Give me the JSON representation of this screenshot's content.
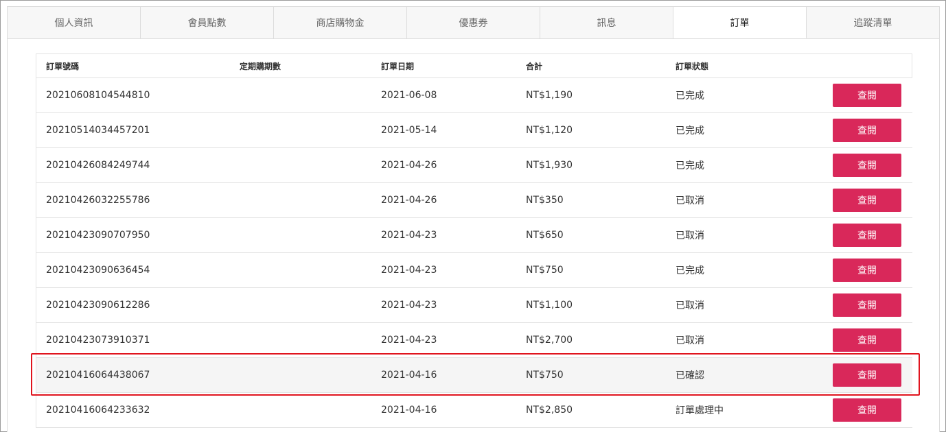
{
  "tabs": [
    {
      "label": "個人資訊",
      "active": false
    },
    {
      "label": "會員點數",
      "active": false
    },
    {
      "label": "商店購物金",
      "active": false
    },
    {
      "label": "優惠券",
      "active": false
    },
    {
      "label": "訊息",
      "active": false
    },
    {
      "label": "訂單",
      "active": true
    },
    {
      "label": "追蹤清單",
      "active": false
    }
  ],
  "table": {
    "headers": [
      "訂單號碼",
      "定期購期數",
      "訂單日期",
      "合計",
      "訂單狀態"
    ],
    "view_label": "查閱",
    "rows": [
      {
        "order_no": "20210608104544810",
        "period": "",
        "date": "2021-06-08",
        "total": "NT$1,190",
        "status": "已完成"
      },
      {
        "order_no": "20210514034457201",
        "period": "",
        "date": "2021-05-14",
        "total": "NT$1,120",
        "status": "已完成"
      },
      {
        "order_no": "20210426084249744",
        "period": "",
        "date": "2021-04-26",
        "total": "NT$1,930",
        "status": "已完成"
      },
      {
        "order_no": "20210426032255786",
        "period": "",
        "date": "2021-04-26",
        "total": "NT$350",
        "status": "已取消"
      },
      {
        "order_no": "20210423090707950",
        "period": "",
        "date": "2021-04-23",
        "total": "NT$650",
        "status": "已取消"
      },
      {
        "order_no": "20210423090636454",
        "period": "",
        "date": "2021-04-23",
        "total": "NT$750",
        "status": "已完成"
      },
      {
        "order_no": "20210423090612286",
        "period": "",
        "date": "2021-04-23",
        "total": "NT$1,100",
        "status": "已取消"
      },
      {
        "order_no": "20210423073910371",
        "period": "",
        "date": "2021-04-23",
        "total": "NT$2,700",
        "status": "已取消"
      },
      {
        "order_no": "20210416064438067",
        "period": "",
        "date": "2021-04-16",
        "total": "NT$750",
        "status": "已確認"
      },
      {
        "order_no": "20210416064233632",
        "period": "",
        "date": "2021-04-16",
        "total": "NT$2,850",
        "status": "訂單處理中"
      }
    ]
  },
  "colors": {
    "button": "#d9285a",
    "highlight_border": "#e0141e"
  }
}
